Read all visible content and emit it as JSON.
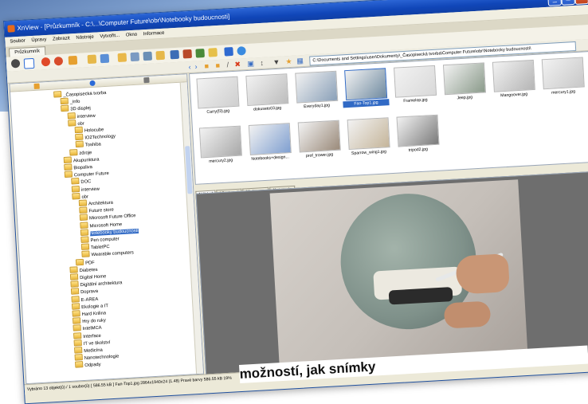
{
  "window": {
    "title": "XnView - [Průzkumník - C:\\...\\Computer Future\\obr\\Notebooky budoucnosti]",
    "btn_min": "_",
    "btn_max": "□",
    "btn_close": "×"
  },
  "menu": [
    "Soubor",
    "Úpravy",
    "Zobrazit",
    "Nástroje",
    "Vytvořit...",
    "Okno",
    "Informace"
  ],
  "tab_label": "Průzkumník",
  "path": "C:\\Documents and Settings\\user\\Dokumenty\\_Časopisecká tvorba\\Computer Future\\obr\\Notebooky budoucnosti\\",
  "tree": [
    {
      "label": "_Časopisecká tvorba",
      "indent": 0
    },
    {
      "label": "_info",
      "indent": 1
    },
    {
      "label": "3D displej",
      "indent": 1
    },
    {
      "label": "interview",
      "indent": 2
    },
    {
      "label": "obr",
      "indent": 2
    },
    {
      "label": "Holocube",
      "indent": 3
    },
    {
      "label": "IO2Technology",
      "indent": 3
    },
    {
      "label": "Toshiba",
      "indent": 3
    },
    {
      "label": "zdroje",
      "indent": 2
    },
    {
      "label": "Akupunktura",
      "indent": 1
    },
    {
      "label": "Biopaliva",
      "indent": 1
    },
    {
      "label": "Computer Future",
      "indent": 1
    },
    {
      "label": "DOC",
      "indent": 2
    },
    {
      "label": "interview",
      "indent": 2
    },
    {
      "label": "obr",
      "indent": 2
    },
    {
      "label": "Architektura",
      "indent": 3
    },
    {
      "label": "Future store",
      "indent": 3
    },
    {
      "label": "Microsoft Future Office",
      "indent": 3
    },
    {
      "label": "Microsoft Home",
      "indent": 3
    },
    {
      "label": "Notebooky budoucnosti",
      "indent": 3,
      "selected": true
    },
    {
      "label": "Pen computer",
      "indent": 3
    },
    {
      "label": "TabletPC",
      "indent": 3
    },
    {
      "label": "Wearable computers",
      "indent": 3
    },
    {
      "label": "PDF",
      "indent": 2
    },
    {
      "label": "Diabetes",
      "indent": 1
    },
    {
      "label": "Digital Home",
      "indent": 1
    },
    {
      "label": "Digitální architektura",
      "indent": 1
    },
    {
      "label": "Doprava",
      "indent": 1
    },
    {
      "label": "E-AREA",
      "indent": 1
    },
    {
      "label": "Ekologie a IT",
      "indent": 1
    },
    {
      "label": "Hard Krilina",
      "indent": 1
    },
    {
      "label": "Hry do ruky",
      "indent": 1
    },
    {
      "label": "IntelMCA",
      "indent": 1
    },
    {
      "label": "Interface",
      "indent": 1
    },
    {
      "label": "IT ve školství",
      "indent": 1
    },
    {
      "label": "Medicína",
      "indent": 1
    },
    {
      "label": "Nanotechnologie",
      "indent": 1
    },
    {
      "label": "Odpady",
      "indent": 1
    }
  ],
  "thumbnails": [
    {
      "label": "Carry(f3).jpg"
    },
    {
      "label": "dokuseto03.jpg"
    },
    {
      "label": "Everyday1.jpg"
    },
    {
      "label": "Fan-Top1.jpg",
      "selected": true
    },
    {
      "label": "Framelop.jpg"
    },
    {
      "label": "Jeep.jpg"
    },
    {
      "label": "Mangoover.jpg"
    },
    {
      "label": "mercury1.jpg"
    },
    {
      "label": "mercury2.jpg"
    },
    {
      "label": "Notebooks+design..."
    },
    {
      "label": "prof_trower.jpg"
    },
    {
      "label": "Sparrow_wing1.jpg"
    },
    {
      "label": "tripod2.jpg"
    }
  ],
  "preview_tabs": [
    "Náhled",
    "Vlastnosti",
    "Histogram",
    "Kategorie"
  ],
  "status": "Vybráno 13 objekt(ů) / 1 soubor(ů) [ 586.55 kB ]   Fan-Top1.jpg   2864x1940x24 (1.48)   Pravé barvy   586.55 kB   19%",
  "caption": "možností, jak snímky"
}
